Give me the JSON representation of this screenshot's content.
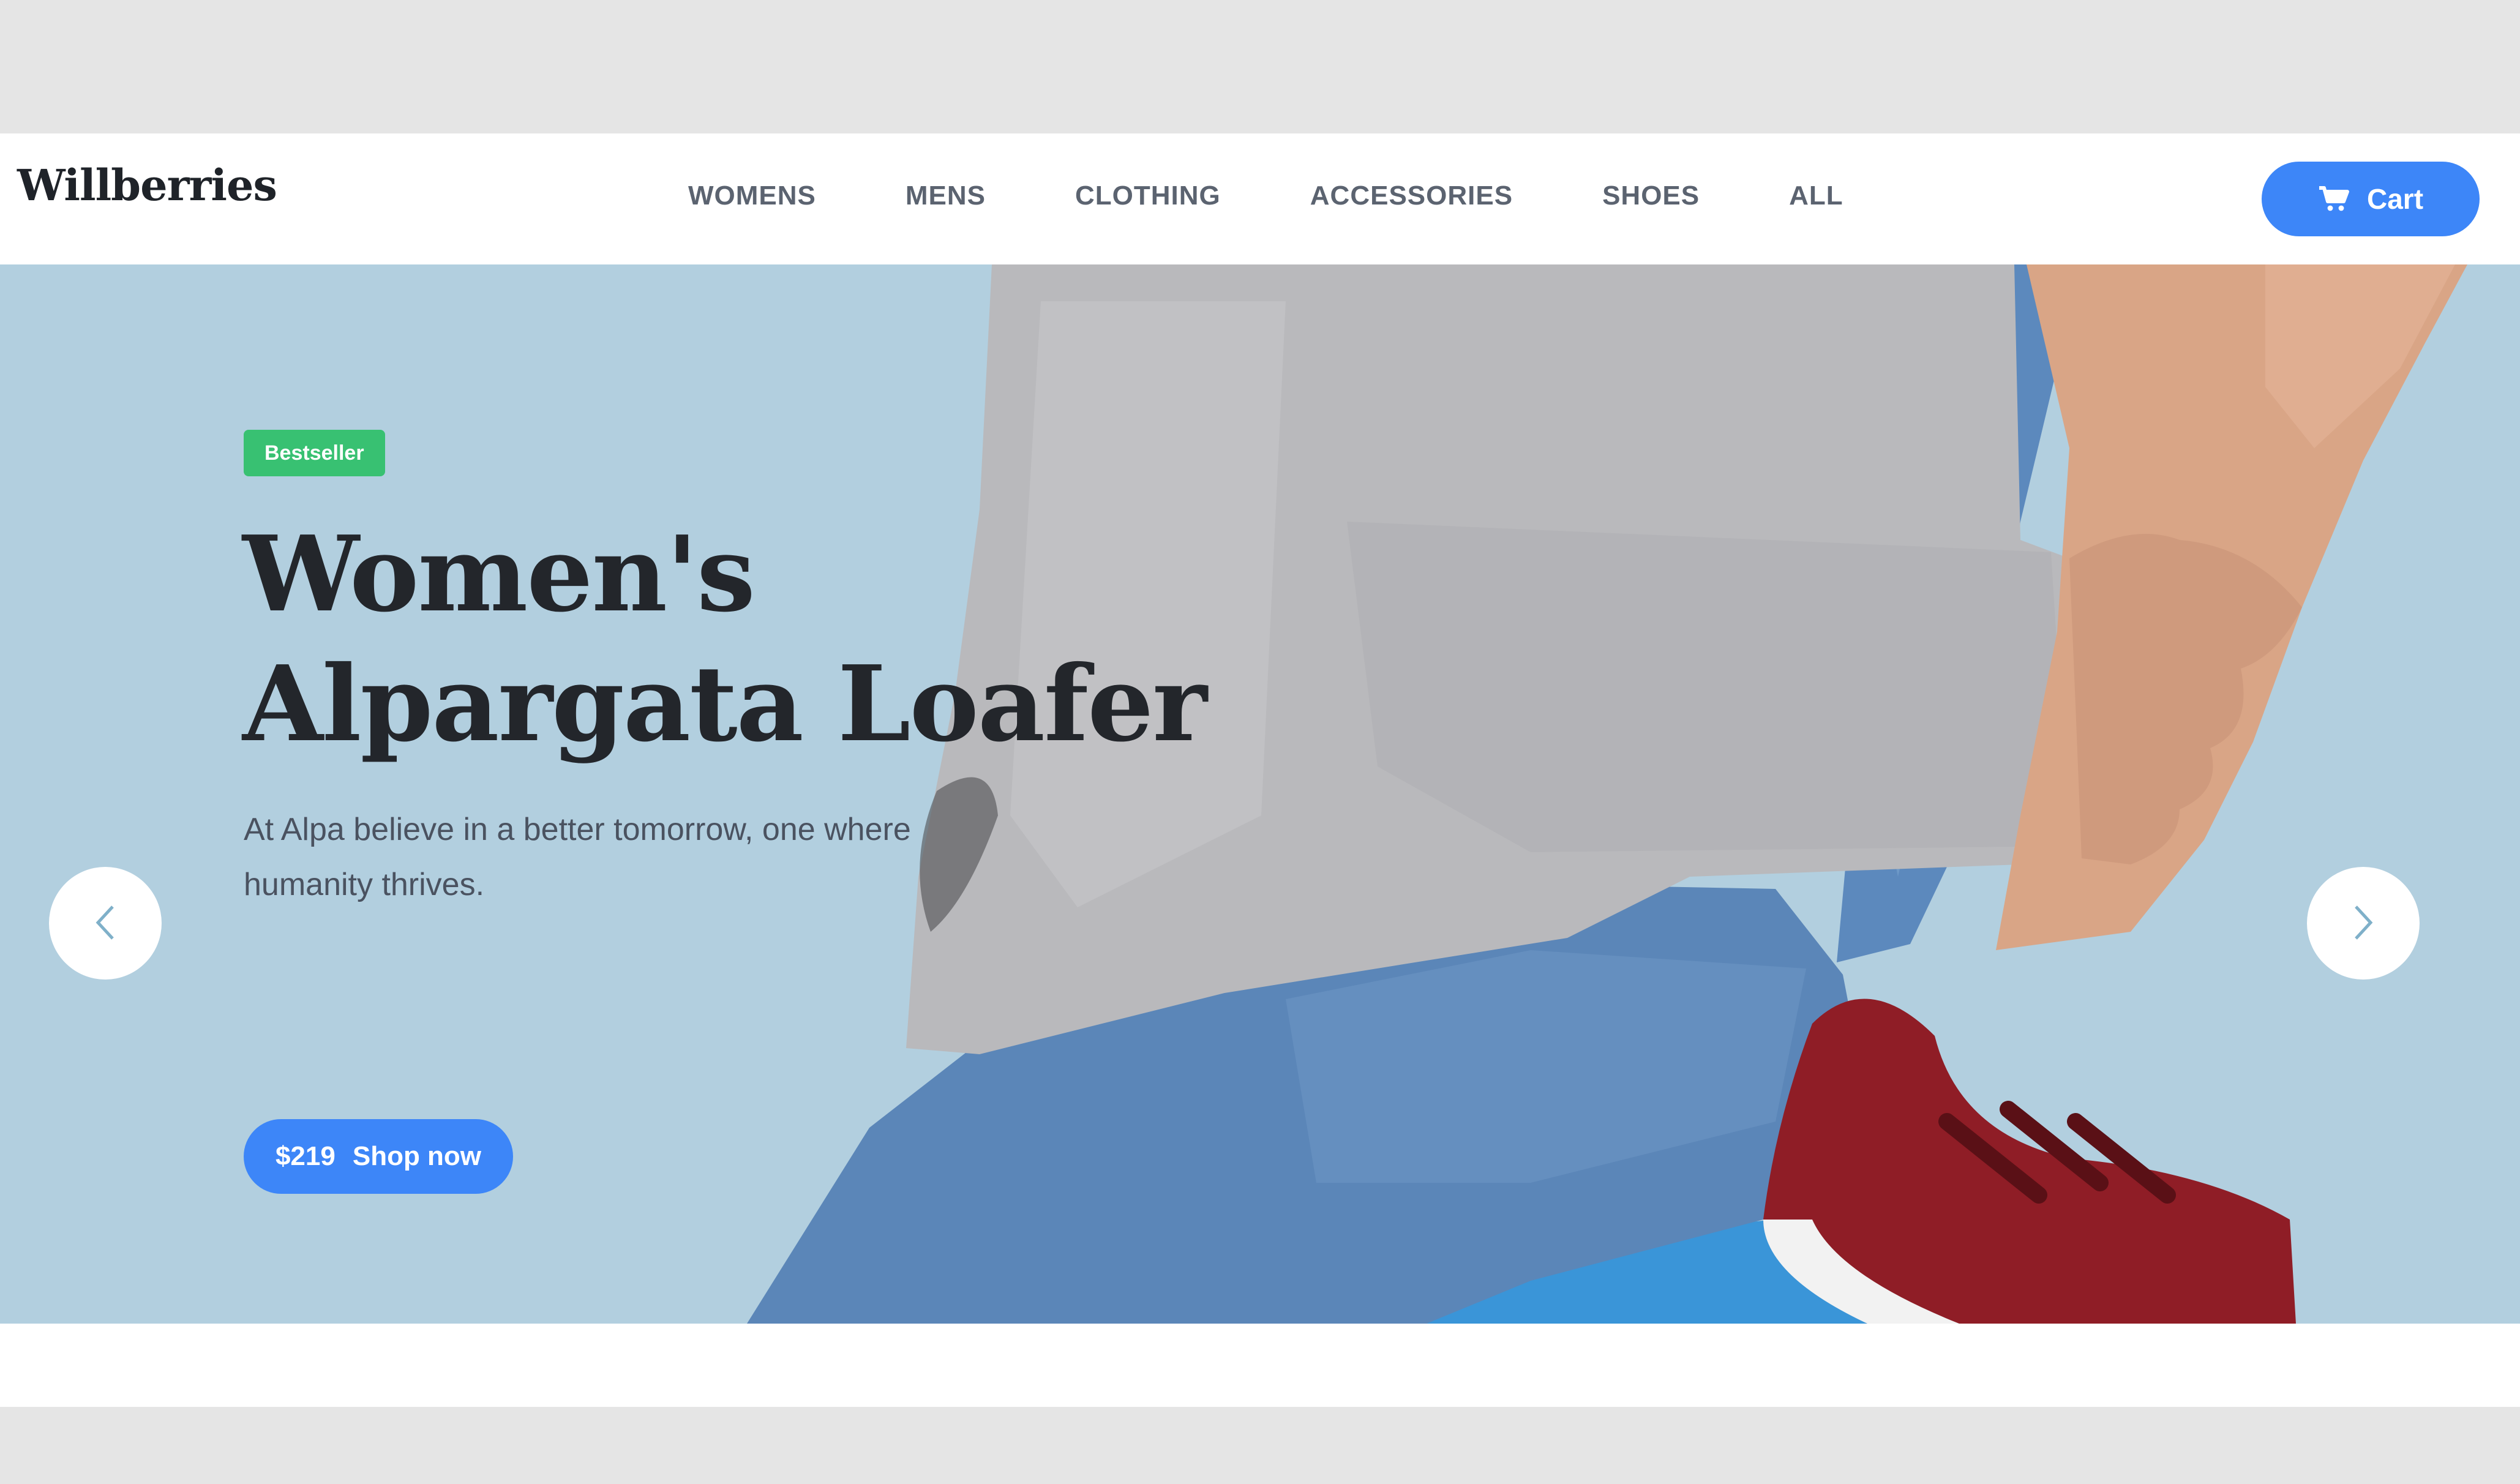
{
  "header": {
    "logo": "Willberries",
    "nav": [
      "WOMENS",
      "MENS",
      "CLOTHING",
      "ACCESSORIES",
      "SHOES",
      "ALL"
    ],
    "cart_label": "Cart",
    "cart_icon": "cart-icon"
  },
  "hero": {
    "badge": "Bestseller",
    "title_line1": "Women's",
    "title_line2": "Alpargata Loafer",
    "description": "At Alpa believe in a better tomorrow, one where humanity thrives.",
    "price": "$219",
    "cta": "Shop now",
    "prev_icon": "chevron-left-icon",
    "next_icon": "chevron-right-icon"
  },
  "colors": {
    "accent": "#3d86f8",
    "badge": "#38c172",
    "hero_bg": "#b2cfdf",
    "text_dark": "#23262b",
    "nav_text": "#5b6370"
  }
}
